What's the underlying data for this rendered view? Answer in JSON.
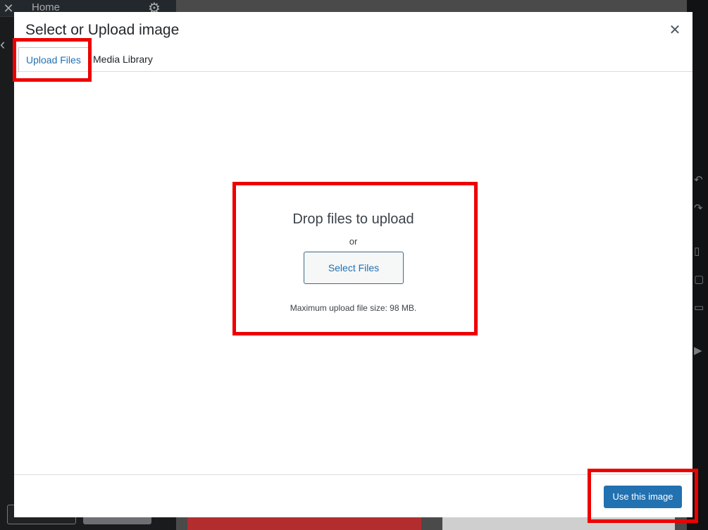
{
  "background": {
    "home_label": "Home",
    "close_glyph": "✕",
    "gear_glyph": "⚙",
    "back_glyph": "‹"
  },
  "modal": {
    "title": "Select or Upload image",
    "close_glyph": "✕",
    "tabs": [
      {
        "label": "Upload Files",
        "active": true
      },
      {
        "label": "Media Library",
        "active": false
      }
    ],
    "uploader": {
      "title": "Drop files to upload",
      "or_text": "or",
      "select_button": "Select Files",
      "max_size_text": "Maximum upload file size: 98 MB."
    },
    "footer": {
      "primary_button": "Use this image"
    }
  },
  "colors": {
    "accent": "#2271b1",
    "highlight": "#ee0000",
    "backdrop": "#1d1f21"
  },
  "icons": [
    "close-icon",
    "gear-icon",
    "chevron-left-icon",
    "undo-icon",
    "redo-icon",
    "mobile-icon",
    "tablet-icon",
    "desktop-icon",
    "play-icon"
  ]
}
